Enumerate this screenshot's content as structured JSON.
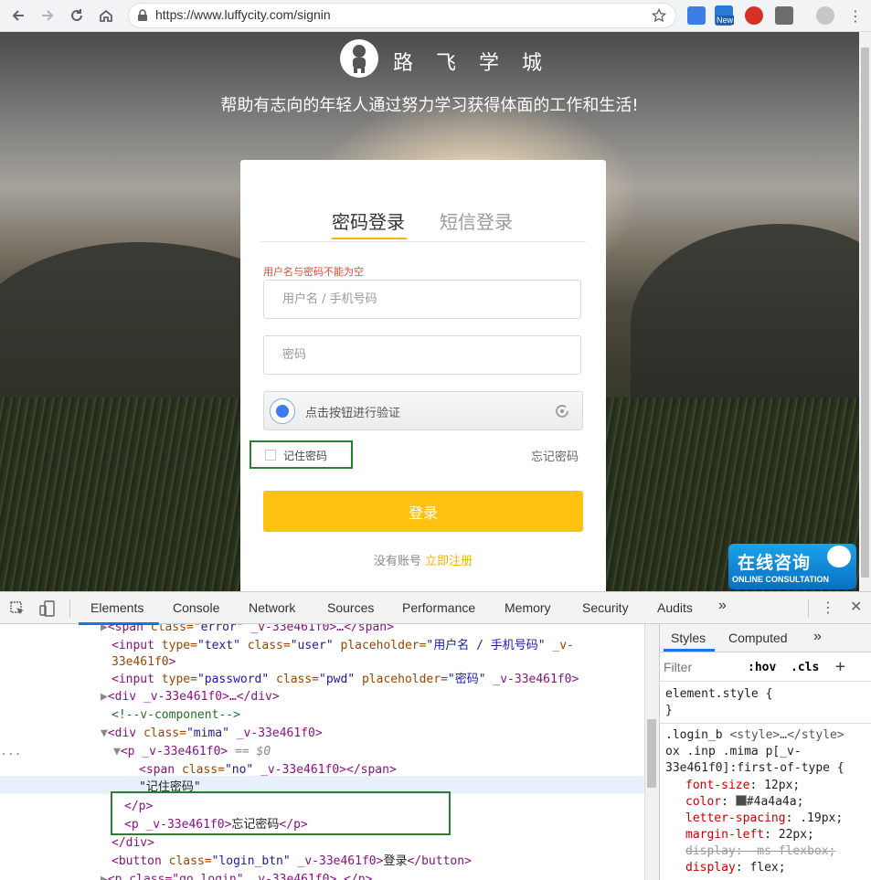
{
  "browser": {
    "url": "https://www.luffycity.com/signin",
    "extensions": [
      "translate-icon",
      "new-badge-icon",
      "opera-icon",
      "window-icon",
      "profile-icon"
    ],
    "new_badge": "New"
  },
  "page": {
    "brand": "路 飞 学 城",
    "slogan": "帮助有志向的年轻人通过努力学习获得体面的工作和生活!",
    "tabs": {
      "password": "密码登录",
      "sms": "短信登录"
    },
    "error": "用户名与密码不能为空",
    "username_placeholder": "用户名 / 手机号码",
    "password_placeholder": "密码",
    "verify_text": "点击按钮进行验证",
    "remember": "记住密码",
    "forgot": "忘记密码",
    "login": "登录",
    "no_account": "没有账号",
    "register": "立即注册",
    "consult_cn": "在线咨询",
    "consult_en": "ONLINE CONSULTATION",
    "accent": "#ffc210"
  },
  "devtools": {
    "tabs": [
      "Elements",
      "Console",
      "Network",
      "Sources",
      "Performance",
      "Memory",
      "Security",
      "Audits"
    ],
    "more": "»",
    "dom": {
      "l1_tag": "<span",
      "l1_attr": "class=",
      "l1_val": "\"error\"",
      "l1_rest": " _v-33e461f0>…</span>",
      "l2_tag": "<input",
      "l2_a1": "type=",
      "l2_v1": "\"text\"",
      "l2_a2": "class=",
      "l2_v2": "\"user\"",
      "l2_a3": "placeholder=",
      "l2_v3": "\"用户名 / 手机号码\"",
      "l2_a4": "_v-",
      "l3_a": "33e461f0",
      "l3_tag": ">",
      "l4_tag": "<input",
      "l4_a1": "type=",
      "l4_v1": "\"password\"",
      "l4_a2": "class=",
      "l4_v2": "\"pwd\"",
      "l4_a3": "placeholder=",
      "l4_v3": "\"密码\"",
      "l4_rest": "_v-33e461f0>",
      "l5": "<div _v-33e461f0>…</div>",
      "l6": "<!--v-component-->",
      "l7_tag": "<div",
      "l7_attr": "class=",
      "l7_val": "\"mima\"",
      "l7_rest": " _v-33e461f0>",
      "l8_tag": "<p",
      "l8_rest": " _v-33e461f0>",
      "l8_eq": "== $0",
      "l9_tag": "<span",
      "l9_attr": "class=",
      "l9_val": "\"no\"",
      "l9_rest": " _v-33e461f0></span>",
      "l10": "\"记住密码\"",
      "l11": "</p>",
      "l12_tag": "<p",
      "l12_rest": " _v-33e461f0>",
      "l12_text": "忘记密码",
      "l12_close": "</p>",
      "l13": "</div>",
      "l14_tag": "<button",
      "l14_attr": "class=",
      "l14_val": "\"login_btn\"",
      "l14_rest": " _v-33e461f0>",
      "l14_text": "登录",
      "l14_close": "</button>",
      "l15": "<p class=\"go_login\" _v-33e461f0>…</p>",
      "ellipsis": "..."
    },
    "styles": {
      "tab_styles": "Styles",
      "tab_computed": "Computed",
      "filter_placeholder": "Filter",
      "hov": ":hov",
      "cls": ".cls",
      "element_style": "element.style {",
      "close_brace": "}",
      "rule1_selector": ".login_b",
      "rule1_source": "<style>…</style>",
      "rule1_sel2": "ox .inp .mima p[_v-",
      "rule1_sel3": "33e461f0]:first-of-type {",
      "p1_name": "font-size",
      "p1_val": "12px;",
      "p2_name": "color",
      "p2_val": "#4a4a4a;",
      "p3_name": "letter-spacing",
      "p3_val": ".19px;",
      "p4_name": "margin-left",
      "p4_val": "22px;",
      "p5_name": "display",
      "p5_val": "-ms-flexbox;",
      "p6_name": "display",
      "p6_val": "flex;",
      "swatch": "#4a4a4a"
    }
  }
}
